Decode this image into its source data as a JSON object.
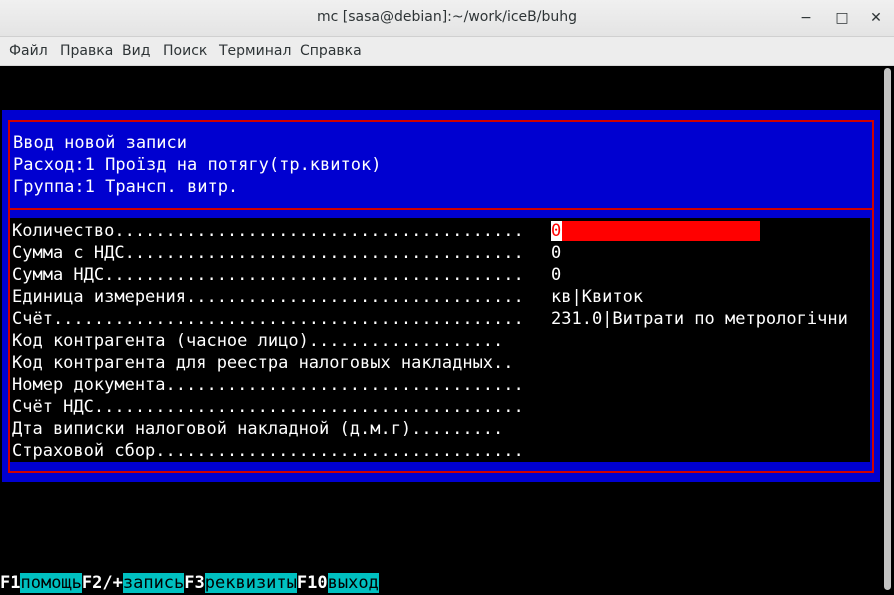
{
  "window": {
    "title": "mc [sasa@debian]:~/work/iceB/buhg",
    "minimize_icon": "minimize-icon",
    "maximize_icon": "maximize-icon",
    "close_icon": "close-icon"
  },
  "menu": [
    "Файл",
    "Правка",
    "Вид",
    "Поиск",
    "Терминал",
    "Справка"
  ],
  "dialog": {
    "heading": "Ввод новой записи",
    "expense": "Расход:1 Проїзд на потягу(тр.квиток)",
    "group": "Группа:1 Трансп. витр.",
    "fields": [
      {
        "label": "Количество........................................",
        "value": "0"
      },
      {
        "label": "Сумма с НДС.......................................",
        "value": "0"
      },
      {
        "label": "Сумма НДС.........................................",
        "value": "0"
      },
      {
        "label": "Единица измерения.................................",
        "value": "кв|Квиток"
      },
      {
        "label": "Счёт..............................................",
        "value": "231.0|Витрати по метрологічни"
      },
      {
        "label": "Код контрагента (часное лицо)...................",
        "value": ""
      },
      {
        "label": "Код контрагента для реестра налоговых накладных..",
        "value": ""
      },
      {
        "label": "Номер документа...................................",
        "value": ""
      },
      {
        "label": "Счёт НДС..........................................",
        "value": ""
      },
      {
        "label": "Дта виписки налоговой накладной (д.м.г).........",
        "value": ""
      },
      {
        "label": "Страховой сбор....................................",
        "value": ""
      }
    ]
  },
  "fkeys": [
    {
      "key": "F1",
      "action": "помощь"
    },
    {
      "key": "F2/+",
      "action": "запись"
    },
    {
      "key": "F3",
      "action": "реквизиты"
    },
    {
      "key": "F10",
      "action": "выход"
    }
  ],
  "colors": {
    "dialog_bg": "#0000d0",
    "frame": "#d00000",
    "edit_field": "#ff0000",
    "fkey_action_bg": "#00c0c0"
  }
}
